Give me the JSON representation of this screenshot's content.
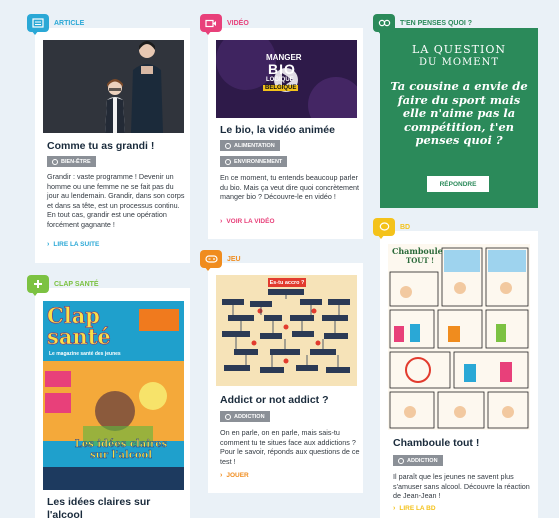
{
  "colors": {
    "article": "#2aa8d6",
    "video": "#e8407a",
    "quiz": "#2b8a5a",
    "clap": "#7cc242",
    "jeu": "#f08c1e",
    "bd": "#f4c21a",
    "badge": "#8b9097"
  },
  "article": {
    "tag": "Article",
    "icon": "newspaper-icon",
    "title": "Comme tu as grandi !",
    "badge": "Bien-être",
    "badge_icon": "stethoscope-icon",
    "description": "Grandir : vaste programme ! Devenir un homme ou une femme ne se fait pas du jour au lendemain. Grandir, dans son corps et dans sa tête, est un processus continu. En tout cas, grandir est une opération forcément gagnante !",
    "cta": "Lire la suite"
  },
  "video": {
    "tag": "Vidéo",
    "icon": "video-camera-icon",
    "thumb_line1": "MANGER",
    "thumb_line2": "BIO",
    "thumb_line3": "LOGIQUE",
    "thumb_line4": "BELGIQUE",
    "title": "Le bio, la vidéo animée",
    "badges": [
      {
        "label": "Alimentation",
        "icon": "apple-icon"
      },
      {
        "label": "Environnement",
        "icon": "leaf-icon"
      }
    ],
    "description": "En ce moment, tu entends beaucoup parler du bio. Mais ça veut dire quoi concrètement manger bio ? Découvre-le en vidéo !",
    "cta": "Voir la vidéo"
  },
  "quiz": {
    "tag": "T'en penses quoi ?",
    "icon": "eyes-icon",
    "heading_line1": "LA QUESTION",
    "heading_line2": "DU MOMENT",
    "question": "Ta cousine a envie de faire du sport mais elle n'aime pas la compétition, t'en penses quoi ?",
    "button": "Répondre"
  },
  "clap": {
    "tag": "Clap santé",
    "icon": "plus-icon",
    "cover_title": "Clap santé",
    "cover_subtitle": "Le magazine santé des jeunes",
    "cover_headline_line1": "Les idées claires",
    "cover_headline_line2": "sur l'alcool",
    "title": "Les idées claires sur l'alcool"
  },
  "jeu": {
    "tag": "Jeu",
    "icon": "gamepad-icon",
    "thumb_heading": "Es-tu accro ?",
    "title": "Addict or not addict ?",
    "badge": "Addiction",
    "badge_icon": "syringe-icon",
    "description": "On en parle, on en parle, mais sais-tu comment tu te situes face aux addictions ? Pour le savoir, réponds aux questions de ce test !",
    "cta": "Jouer"
  },
  "bd": {
    "tag": "BD",
    "icon": "speech-bubble-icon",
    "comic_title_line1": "Chamboule",
    "comic_title_line2": "TOUT !",
    "title": "Chamboule tout !",
    "badge": "Addiction",
    "badge_icon": "syringe-icon",
    "description": "Il paraît que les jeunes ne savent plus s'amuser sans alcool. Découvre la réaction de Jean-Jean !",
    "cta": "Lire la BD"
  }
}
